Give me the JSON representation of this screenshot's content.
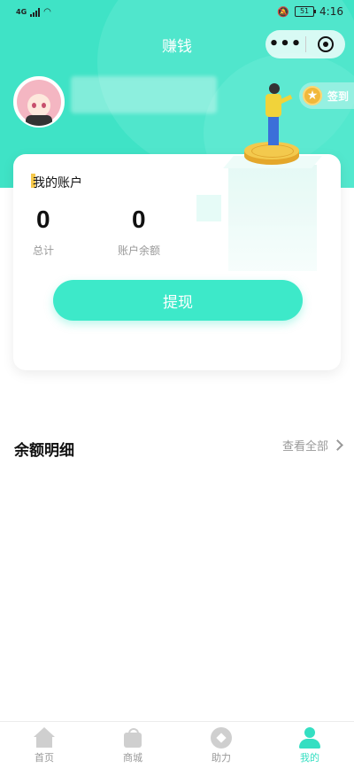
{
  "status_bar": {
    "network": "4G",
    "time": "4:16",
    "battery": "51"
  },
  "header": {
    "title": "赚钱",
    "menu_dots": "•••",
    "accent_color": "#3fe3c6"
  },
  "profile": {
    "signin_label": "签到"
  },
  "account_card": {
    "title": "我的账户",
    "total_value": "0",
    "total_label": "总计",
    "balance_value": "0",
    "balance_label": "账户余额",
    "withdraw_label": "提现"
  },
  "balance_detail": {
    "title": "余额明细",
    "view_all": "查看全部"
  },
  "tabbar": {
    "items": [
      {
        "label": "首页",
        "icon": "home-icon"
      },
      {
        "label": "商城",
        "icon": "shop-icon"
      },
      {
        "label": "助力",
        "icon": "help-icon"
      },
      {
        "label": "我的",
        "icon": "me-icon",
        "active": true
      }
    ],
    "active_color": "#34dfc2"
  }
}
